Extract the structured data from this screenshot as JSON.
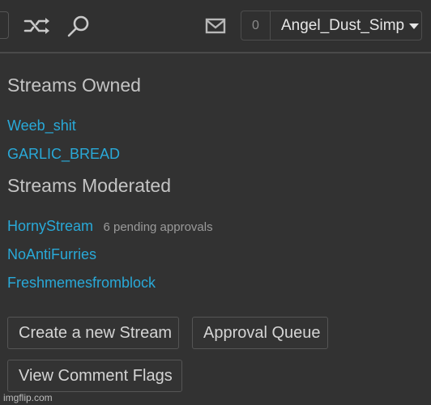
{
  "header": {
    "icons": [
      "shuffle-icon",
      "search-icon",
      "mail-icon"
    ],
    "notification_count": "0",
    "username": "Angel_Dust_Simp"
  },
  "streams_owned": {
    "title": "Streams Owned",
    "items": [
      {
        "name": "Weeb_shit"
      },
      {
        "name": "GARLIC_BREAD"
      }
    ]
  },
  "streams_moderated": {
    "title": "Streams Moderated",
    "items": [
      {
        "name": "HornyStream",
        "note": "6 pending approvals"
      },
      {
        "name": "NoAntiFurries"
      },
      {
        "name": "Freshmemesfromblock"
      }
    ]
  },
  "actions": {
    "create": "Create a new Stream",
    "approval": "Approval Queue",
    "flags": "View Comment Flags"
  },
  "watermark": "imgflip.com",
  "colors": {
    "background": "#323232",
    "link": "#29a9d8",
    "heading": "#c4c4c4"
  }
}
